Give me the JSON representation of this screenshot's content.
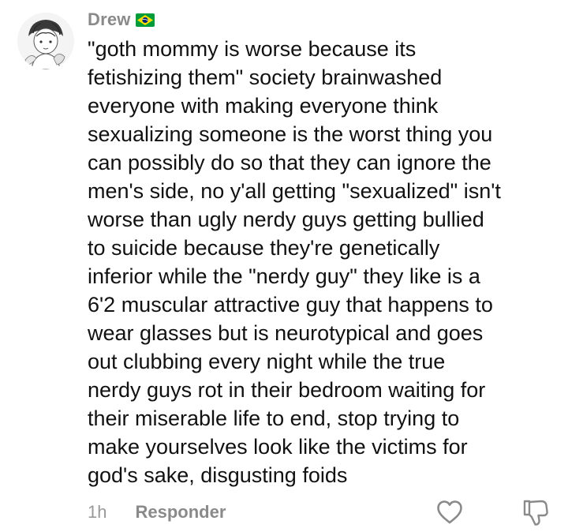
{
  "comment": {
    "author": "Drew",
    "author_flag": "brazil-flag-icon",
    "text": "\"goth mommy is worse because its\nfetishizing them\" society brainwashed\neveryone with making everyone think\nsexualizing someone is the worst thing you\ncan possibly do so that they can ignore the\nmen's side, no y'all getting \"sexualized\" isn't\nworse than ugly nerdy guys getting bullied\nto suicide because they're genetically\ninferior while the \"nerdy guy\" they like is a\n6'2 muscular attractive guy that happens to\nwear glasses but is neurotypical and goes\nout clubbing every night while the true\nnerdy guys rot in their bedroom waiting for\ntheir miserable life to end, stop trying to\nmake yourselves look like the victims for\ngod's sake, disgusting foids",
    "time": "1h",
    "reply_label": "Responder"
  },
  "icons": {
    "like": "heart-outline-icon",
    "dislike": "thumbs-down-outline-icon"
  },
  "colors": {
    "text": "#111111",
    "meta": "#8a8a8a",
    "icon": "#8a8a8a",
    "flag_green": "#009b3a",
    "flag_yellow": "#fedf00",
    "flag_blue": "#002776"
  }
}
